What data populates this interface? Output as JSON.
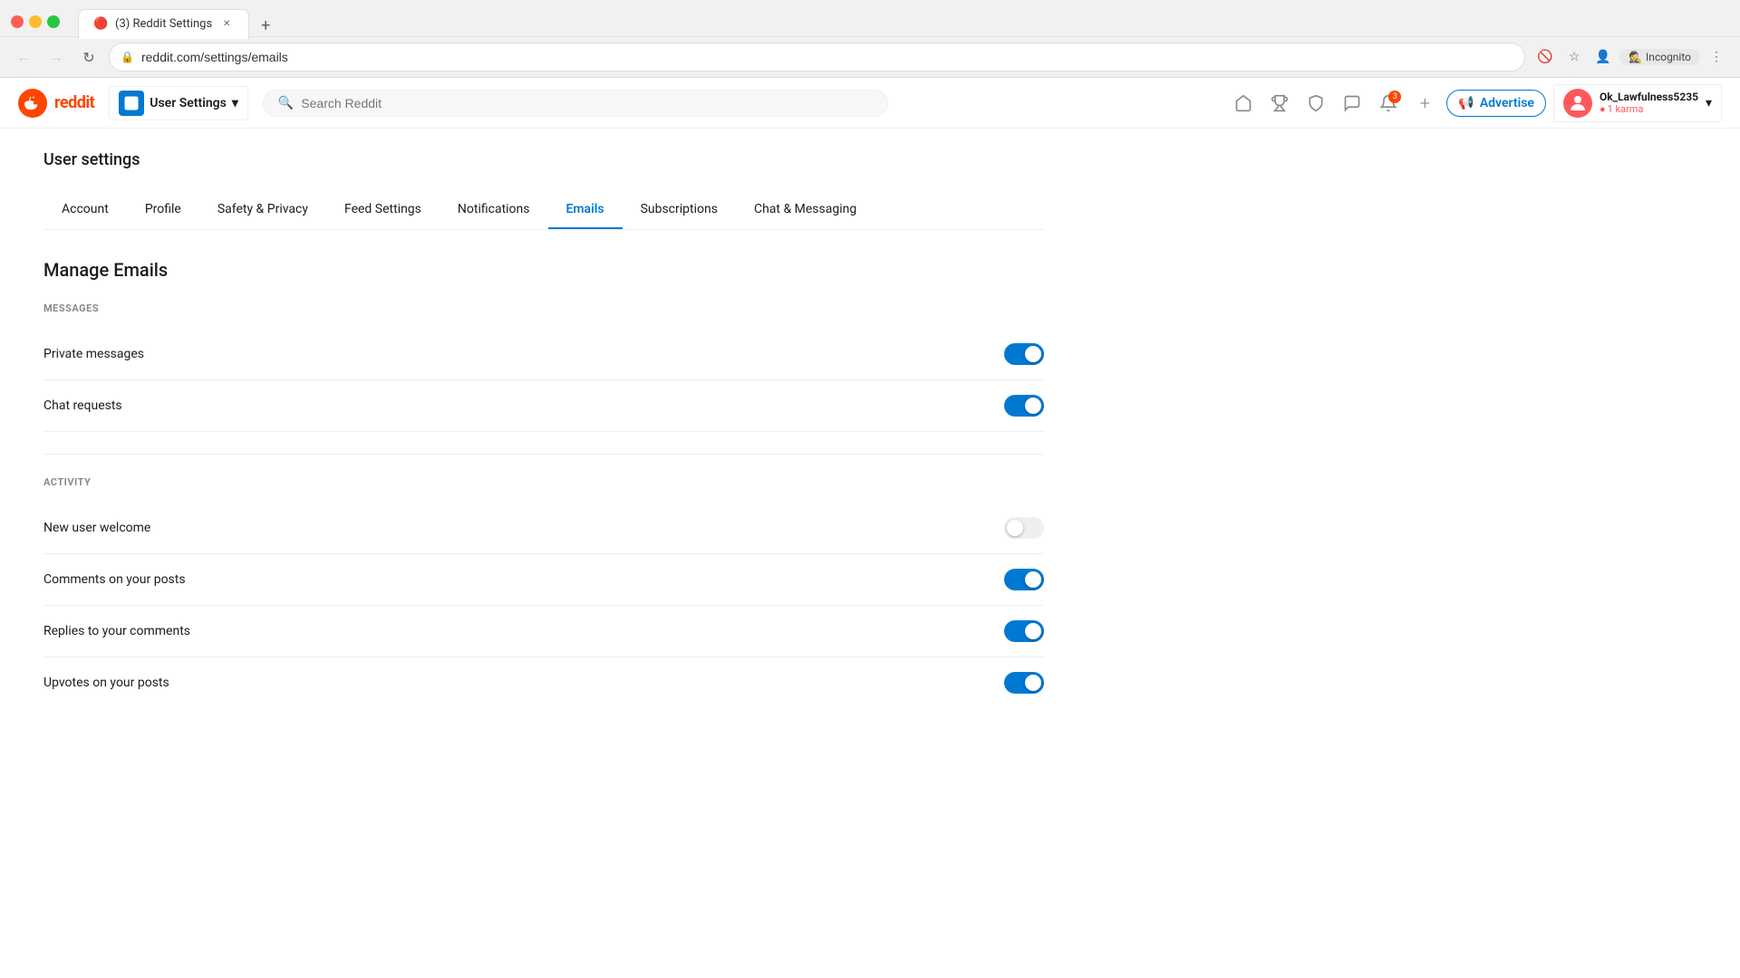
{
  "browser": {
    "tab_title": "(3) Reddit Settings",
    "tab_favicon": "🔴",
    "address": "reddit.com/settings/emails",
    "incognito_label": "Incognito"
  },
  "header": {
    "logo_text": "reddit",
    "user_settings_label": "User Settings",
    "search_placeholder": "Search Reddit",
    "advertise_label": "Advertise",
    "username": "Ok_Lawfulness5235",
    "karma": "1 karma",
    "notification_count": "3"
  },
  "page": {
    "title": "User settings",
    "manage_title": "Manage Emails"
  },
  "tabs": [
    {
      "id": "account",
      "label": "Account",
      "active": false
    },
    {
      "id": "profile",
      "label": "Profile",
      "active": false
    },
    {
      "id": "safety",
      "label": "Safety & Privacy",
      "active": false
    },
    {
      "id": "feed",
      "label": "Feed Settings",
      "active": false
    },
    {
      "id": "notifications",
      "label": "Notifications",
      "active": false
    },
    {
      "id": "emails",
      "label": "Emails",
      "active": true
    },
    {
      "id": "subscriptions",
      "label": "Subscriptions",
      "active": false
    },
    {
      "id": "chat",
      "label": "Chat & Messaging",
      "active": false
    }
  ],
  "sections": [
    {
      "id": "messages",
      "label": "MESSAGES",
      "settings": [
        {
          "id": "private-messages",
          "label": "Private messages",
          "enabled": true
        },
        {
          "id": "chat-requests",
          "label": "Chat requests",
          "enabled": true
        }
      ]
    },
    {
      "id": "activity",
      "label": "ACTIVITY",
      "settings": [
        {
          "id": "new-user-welcome",
          "label": "New user welcome",
          "enabled": false
        },
        {
          "id": "comments-on-posts",
          "label": "Comments on your posts",
          "enabled": true
        },
        {
          "id": "replies-to-comments",
          "label": "Replies to your comments",
          "enabled": true
        },
        {
          "id": "upvotes-on-posts",
          "label": "Upvotes on your posts",
          "enabled": true
        }
      ]
    }
  ]
}
